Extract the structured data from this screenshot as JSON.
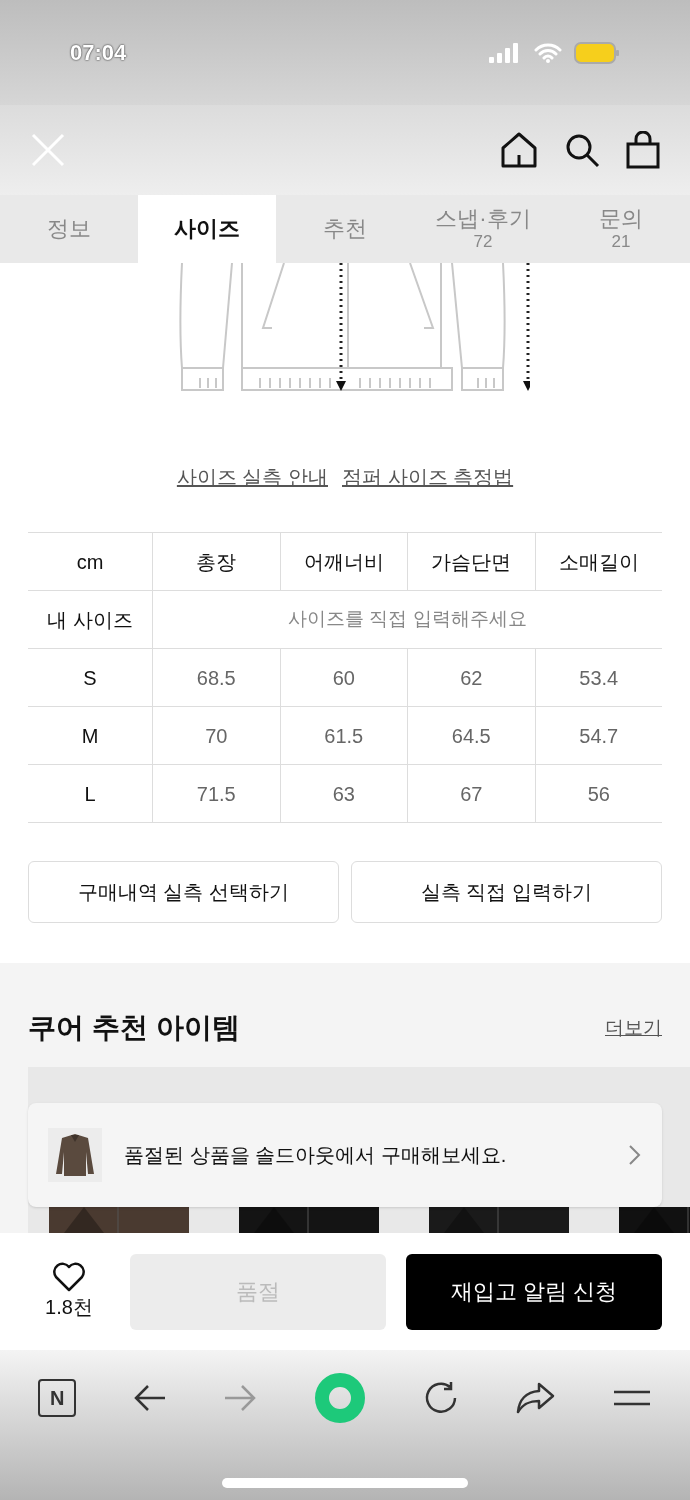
{
  "status_bar": {
    "time": "07:04"
  },
  "tabs": [
    {
      "label": "정보",
      "selected": false
    },
    {
      "label": "사이즈",
      "selected": true
    },
    {
      "label": "추천",
      "selected": false
    },
    {
      "label": "스냅·후기",
      "count": "72",
      "selected": false
    },
    {
      "label": "문의",
      "count": "21",
      "selected": false
    }
  ],
  "size_guide": {
    "links": [
      "사이즈 실측 안내",
      "점퍼 사이즈 측정법"
    ]
  },
  "size_table": {
    "columns": [
      "cm",
      "총장",
      "어깨너비",
      "가슴단면",
      "소매길이"
    ],
    "my_size": {
      "label": "내 사이즈",
      "placeholder": "사이즈를 직접 입력해주세요"
    },
    "rows": [
      [
        "S",
        "68.5",
        "60",
        "62",
        "53.4"
      ],
      [
        "M",
        "70",
        "61.5",
        "64.5",
        "54.7"
      ],
      [
        "L",
        "71.5",
        "63",
        "67",
        "56"
      ]
    ]
  },
  "size_buttons": [
    "구매내역 실측 선택하기",
    "실측 직접 입력하기"
  ],
  "recommend": {
    "title": "쿠어 추천 아이템",
    "more": "더보기"
  },
  "soldout_banner": {
    "text": "품절된 상품을 솔드아웃에서 구매해보세요."
  },
  "action_bar": {
    "like_count": "1.8천",
    "soldout_button": {
      "label": "품절",
      "disabled": true
    },
    "restock_button": {
      "label": "재입고 알림 신청",
      "disabled": false
    }
  },
  "browser_bar": {
    "home_label": "N"
  }
}
